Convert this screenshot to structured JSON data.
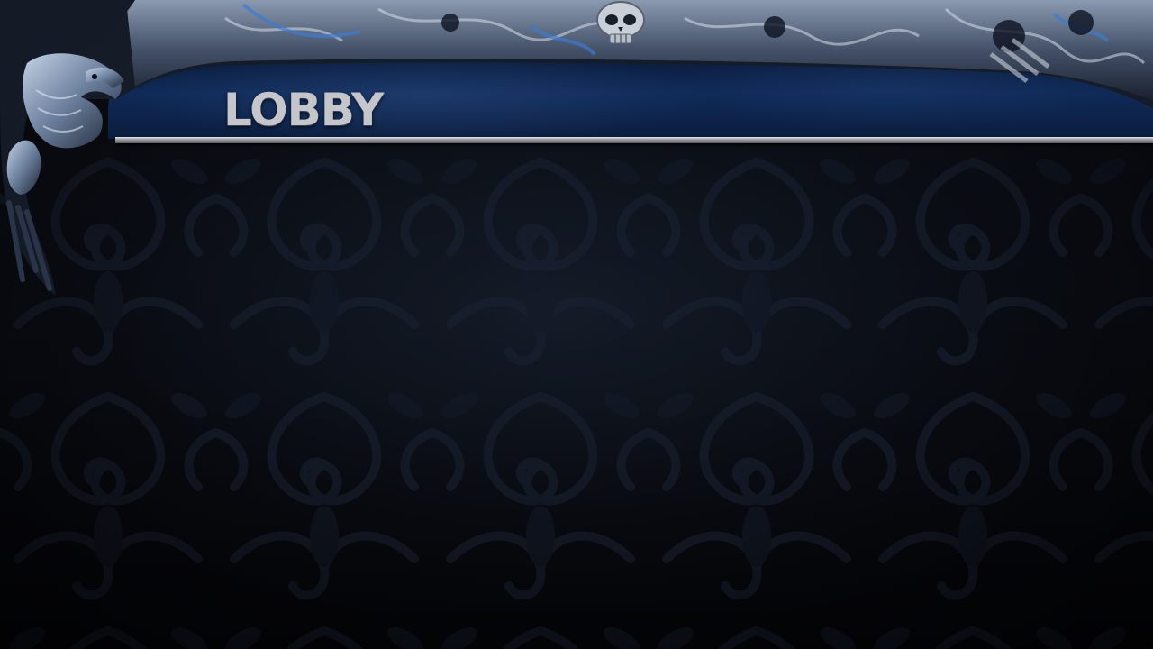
{
  "screen": {
    "title": "LOBBY"
  },
  "theme": {
    "banner_color": "#0f2a58",
    "title_color": "#c4c6cc",
    "background_color": "#080a10",
    "rule_color": "#9a9ca2"
  },
  "decorations": {
    "left_ornament": "eagle-icon",
    "top_ornament": "skull-icon",
    "background_motif": "damask-swirl-pattern"
  }
}
